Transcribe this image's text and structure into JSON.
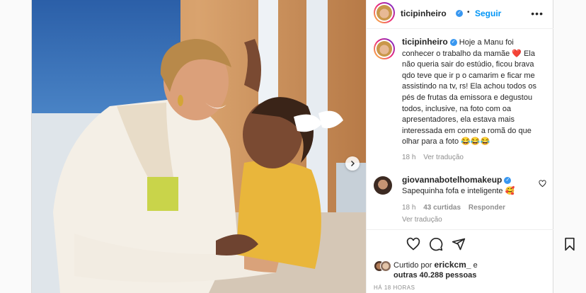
{
  "post": {
    "username": "ticipinheiro",
    "follow_label": "Seguir",
    "separator": "•",
    "caption_text": "Hoje a Manu foi conhecer o trabalho da mamãe ❤️ Ela não queria sair do estúdio, ficou brava qdo teve que ir p o camarim e ficar me assistindo na tv, rs! Ela achou todos os pés de frutas da emissora e degustou todos, inclusive, na foto com oa apresentadores, ela estava mais interessada em comer a romã do que olhar para a foto 😂😂😂",
    "caption_time": "18 h",
    "caption_translate": "Ver tradução"
  },
  "comment": {
    "username": "giovannabotelhomakeup",
    "text": "Sapequinha fofa e inteligente 🥰",
    "time": "18 h",
    "likes": "43 curtidas",
    "reply": "Responder",
    "translate": "Ver tradução"
  },
  "likes": {
    "prefix": "Curtido por",
    "user": "erickcm_",
    "joiner": "e",
    "others": "outras 40.288 pessoas"
  },
  "timestamp": "HÁ 18 HORAS",
  "icons": {
    "verified": "verified-badge-icon",
    "more": "more-options-icon",
    "next": "chevron-right-icon",
    "heart": "heart-icon",
    "comment": "comment-icon",
    "share": "share-icon",
    "save": "bookmark-icon"
  },
  "colors": {
    "accent": "#0095f6",
    "verified": "#3897f0",
    "muted": "#8e8e8e"
  }
}
